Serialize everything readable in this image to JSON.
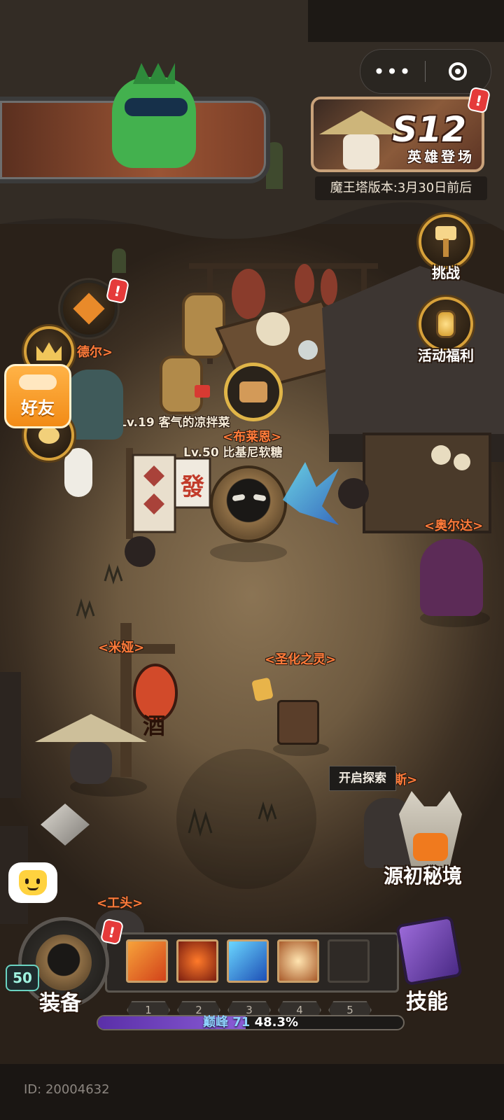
{
  "top_capsule": {
    "more_icon": "more-dots-icon",
    "close_icon": "target-circle-icon"
  },
  "season": {
    "title": "S12",
    "subtitle": "英雄登场",
    "version_note": "魔王塔版本:3月30日前后"
  },
  "right_buttons": [
    {
      "label": "挑战",
      "icon": "hammer-icon"
    },
    {
      "label": "活动福利",
      "icon": "lantern-icon"
    }
  ],
  "left_menu": {
    "friends_label": "好友",
    "partial_npc_label": "德尔"
  },
  "npcs": {
    "blaine": "<布莱恩>",
    "orda": "<奥尔达>",
    "mia": "<米娅>",
    "sanctified_spirit": "<圣化之灵>",
    "carlos": "<卡洛斯>",
    "foreman": "<工头>"
  },
  "players": {
    "other": "Lv.19 客气的凉拌菜",
    "self": "Lv.50 比基尼软糖"
  },
  "props": {
    "lantern_char": "酒",
    "banner_char": "發"
  },
  "dungeon": {
    "label": "源初秘境",
    "explore_tag": "开启探索"
  },
  "hud": {
    "equip_label": "装备",
    "skills_label": "技能",
    "level": "50",
    "slot_numbers": [
      "1",
      "2",
      "3",
      "4",
      "5"
    ],
    "rank_text": "巅峰 71",
    "xp_percent_text": "48.3%",
    "xp_progress": 0.483
  },
  "player_id": "ID: 20004632",
  "colors": {
    "npc_name": "#ff7b3a",
    "gold_ring": "#d7a13a",
    "xp_fill": "#7a4cc8",
    "friends_orange": "#f59a22"
  }
}
